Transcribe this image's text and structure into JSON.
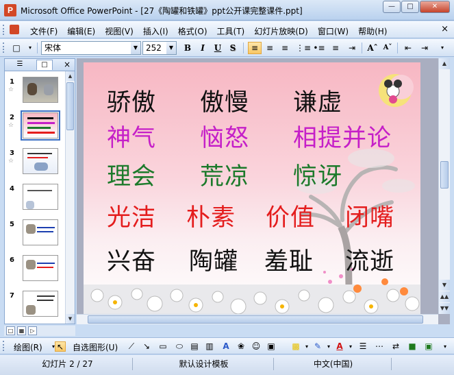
{
  "window": {
    "title": "Microsoft Office PowerPoint - [27《陶罐和铁罐》ppt公开课完整课件.ppt]",
    "app_icon": "powerpoint-icon",
    "minimize": "—",
    "maximize": "□",
    "close": "✕"
  },
  "menu": {
    "items": [
      "文件(F)",
      "编辑(E)",
      "视图(V)",
      "插入(I)",
      "格式(O)",
      "工具(T)",
      "幻灯片放映(D)",
      "窗口(W)",
      "帮助(H)"
    ],
    "close": "×"
  },
  "toolbar": {
    "font_name": "宋体",
    "font_size": "252",
    "bold": "B",
    "italic": "I",
    "underline": "U",
    "shadow": "S",
    "align_left_active": true
  },
  "pane": {
    "close": "×",
    "slides": [
      {
        "num": "1",
        "star": "☆"
      },
      {
        "num": "2",
        "star": "☆"
      },
      {
        "num": "3",
        "star": "☆"
      },
      {
        "num": "4",
        "star": ""
      },
      {
        "num": "5",
        "star": ""
      },
      {
        "num": "6",
        "star": ""
      },
      {
        "num": "7",
        "star": ""
      }
    ],
    "selected": 2
  },
  "slide": {
    "rows": [
      {
        "color": "black",
        "words": [
          "骄傲",
          "傲慢",
          "谦虚"
        ]
      },
      {
        "color": "magenta",
        "words": [
          "神气",
          "恼怒",
          "相提并论"
        ]
      },
      {
        "color": "green",
        "words": [
          "理会",
          "荒凉",
          "惊讶"
        ]
      },
      {
        "color": "red",
        "words": [
          "光洁",
          "朴素",
          "价值",
          "闭嘴"
        ]
      },
      {
        "color": "black",
        "words": [
          "兴奋",
          "陶罐",
          "羞耻",
          "流逝"
        ]
      }
    ],
    "colors": {
      "black": "#111111",
      "magenta": "#c51fc8",
      "green": "#1c7a2b",
      "red": "#e41d1d"
    }
  },
  "drawbar": {
    "draw_label": "绘图(R)",
    "autoshape_label": "自选图形(U)"
  },
  "status": {
    "slide_info": "幻灯片 2 / 27",
    "template": "默认设计模板",
    "language": "中文(中国)"
  }
}
